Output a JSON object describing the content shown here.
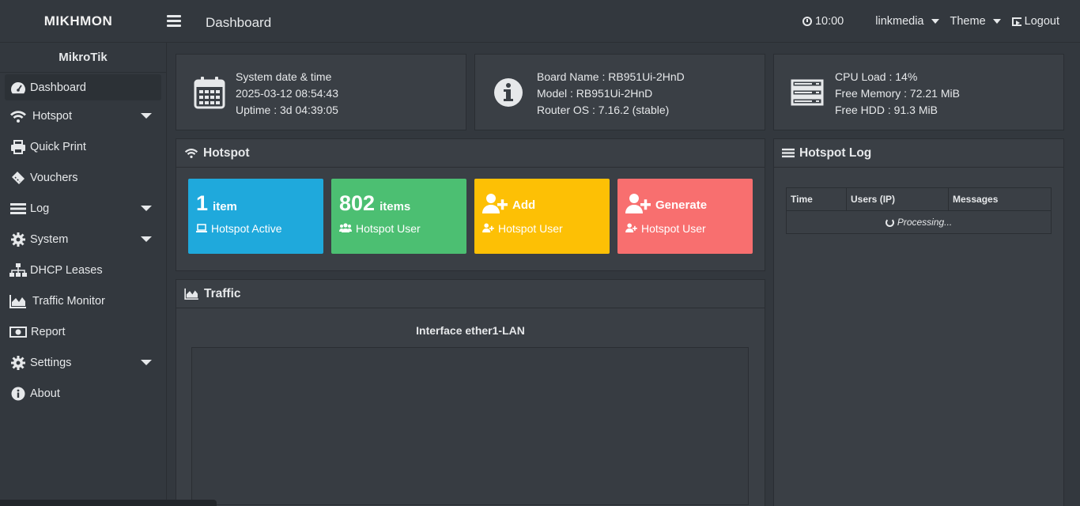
{
  "brand": "MIKHMON",
  "header": {
    "title": "Dashboard",
    "clock": "10:00",
    "session": "linkmedia",
    "theme": "Theme",
    "logout": "Logout"
  },
  "sidebar": {
    "title": "MikroTik",
    "items": [
      {
        "label": "Dashboard",
        "icon": "dashboard-icon"
      },
      {
        "label": "Hotspot",
        "icon": "wifi-icon"
      },
      {
        "label": "Quick Print",
        "icon": "print-icon"
      },
      {
        "label": "Vouchers",
        "icon": "ticket-icon"
      },
      {
        "label": "Log",
        "icon": "list-icon"
      },
      {
        "label": "System",
        "icon": "gear-icon"
      },
      {
        "label": "DHCP Leases",
        "icon": "sitemap-icon"
      },
      {
        "label": "Traffic Monitor",
        "icon": "area-chart-icon"
      },
      {
        "label": "Report",
        "icon": "money-icon"
      },
      {
        "label": "Settings",
        "icon": "gear-icon"
      },
      {
        "label": "About",
        "icon": "info-icon"
      }
    ]
  },
  "system_box": {
    "line1": "System date & time",
    "line2": "2025-03-12 08:54:43",
    "line3": "Uptime : 3d 04:39:05"
  },
  "board_box": {
    "line1": "Board Name : RB951Ui-2HnD",
    "line2": "Model : RB951Ui-2HnD",
    "line3": "Router OS : 7.16.2 (stable)"
  },
  "resource_box": {
    "line1": "CPU Load : 14%",
    "line2": "Free Memory : 72.21 MiB",
    "line3": "Free HDD : 91.3 MiB"
  },
  "hotspot": {
    "title": "Hotspot",
    "tiles": [
      {
        "num": "1",
        "unit": "item",
        "sub": "Hotspot Active",
        "color": "#1fa9dc"
      },
      {
        "num": "802",
        "unit": "items",
        "sub": "Hotspot User",
        "color": "#4cbf72"
      },
      {
        "action": "Add",
        "sub": "Hotspot User",
        "color": "#fdc005"
      },
      {
        "action": "Generate",
        "sub": "Hotspot User",
        "color": "#f86f6f"
      }
    ]
  },
  "traffic": {
    "title": "Traffic",
    "interface": "Interface ether1-LAN"
  },
  "log": {
    "title": "Hotspot Log",
    "columns": [
      "Time",
      "Users (IP)",
      "Messages"
    ],
    "status": "Processing..."
  }
}
